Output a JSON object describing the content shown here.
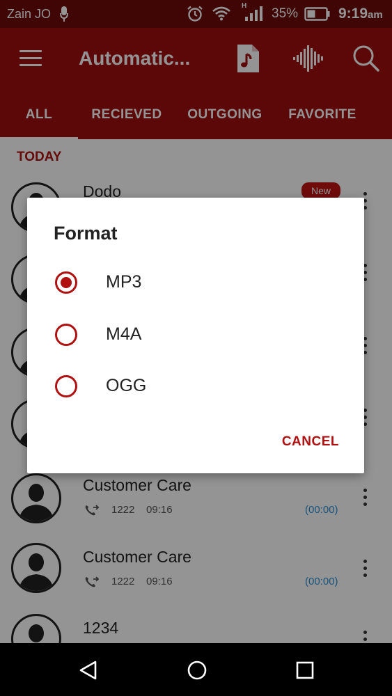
{
  "status_bar": {
    "carrier": "Zain JO",
    "network_type": "H",
    "battery_percent": "35%",
    "time": "9:19",
    "time_suffix": "am"
  },
  "app_bar": {
    "title": "Automatic...",
    "icons": [
      "menu-icon",
      "music-note-icon",
      "audio-wave-icon",
      "search-icon"
    ]
  },
  "tabs": [
    {
      "label": "ALL",
      "selected": true
    },
    {
      "label": "RECIEVED",
      "selected": false
    },
    {
      "label": "OUTGOING",
      "selected": false
    },
    {
      "label": "FAVORITE",
      "selected": false
    }
  ],
  "list": {
    "section_header": "TODAY",
    "items": [
      {
        "name": "Dodo",
        "badge": "New"
      },
      {
        "name": "Customer Care",
        "number": "1222",
        "time": "09:16",
        "duration": "(00:00)"
      },
      {
        "name": "Customer Care",
        "number": "1222",
        "time": "09:16",
        "duration": "(00:00)"
      },
      {
        "name": "1234"
      }
    ]
  },
  "dialog": {
    "title": "Format",
    "options": [
      {
        "label": "MP3",
        "selected": true
      },
      {
        "label": "M4A",
        "selected": false
      },
      {
        "label": "OGG",
        "selected": false
      }
    ],
    "cancel_label": "CANCEL"
  },
  "colors": {
    "status_bar": "#6e0a0a",
    "app_bar": "#a00e0e",
    "accent": "#b01010",
    "duration_text": "#2a8fd6"
  }
}
